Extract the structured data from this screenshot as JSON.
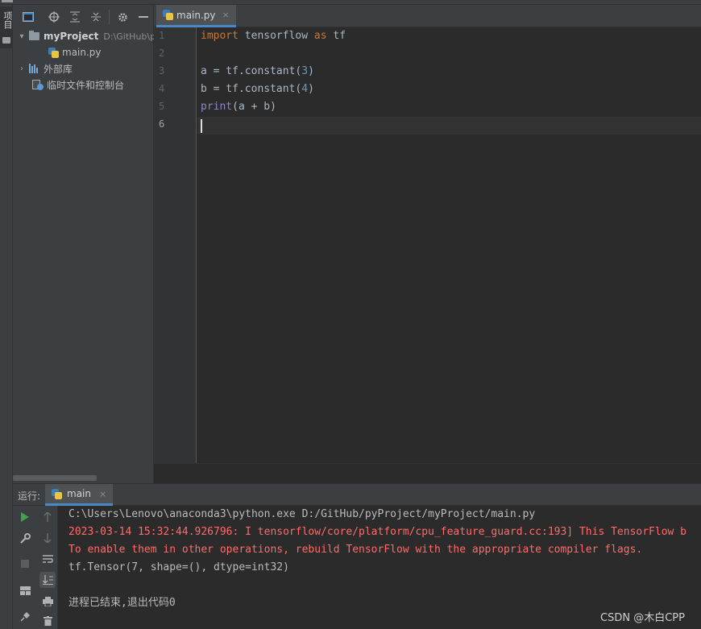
{
  "left_stripe": {
    "project_tab_label": "项目"
  },
  "project_panel": {
    "root": {
      "name": "myProject",
      "path": "D:\\GitHub\\p"
    },
    "files": [
      {
        "name": "main.py"
      }
    ],
    "external_libs": "外部库",
    "scratches": "临时文件和控制台"
  },
  "editor": {
    "tab": {
      "label": "main.py",
      "close": "×"
    },
    "line_numbers": [
      "1",
      "2",
      "3",
      "4",
      "5",
      "6"
    ],
    "code": {
      "l1_kw1": "import",
      "l1_mod": " tensorflow ",
      "l1_kw2": "as",
      "l1_alias": " tf",
      "l3_pre": "a = tf.constant(",
      "l3_num": "3",
      "l3_post": ")",
      "l4_pre": "b = tf.constant(",
      "l4_num": "4",
      "l4_post": ")",
      "l5_fn": "print",
      "l5_args": "(a + b)"
    }
  },
  "run": {
    "title": "运行:",
    "tab_label": "main",
    "tab_close": "×",
    "console": [
      {
        "text": "C:\\Users\\Lenovo\\anaconda3\\python.exe D:/GitHub/pyProject/myProject/main.py",
        "kind": "normal"
      },
      {
        "text": "2023-03-14 15:32:44.926796: I tensorflow/core/platform/cpu_feature_guard.cc:193] This TensorFlow b",
        "kind": "error"
      },
      {
        "text": "To enable them in other operations, rebuild TensorFlow with the appropriate compiler flags.",
        "kind": "error"
      },
      {
        "text": "tf.Tensor(7, shape=(), dtype=int32)",
        "kind": "normal"
      },
      {
        "text": "",
        "kind": "normal"
      },
      {
        "text": "进程已结束,退出代码0",
        "kind": "normal"
      }
    ]
  },
  "watermark": "CSDN @木白CPP",
  "colors": {
    "accent": "#4a88c7",
    "keyword": "#cc7832",
    "number": "#6897bb",
    "builtin": "#8888c6",
    "error": "#ff6b68",
    "run_green": "#499c54"
  }
}
